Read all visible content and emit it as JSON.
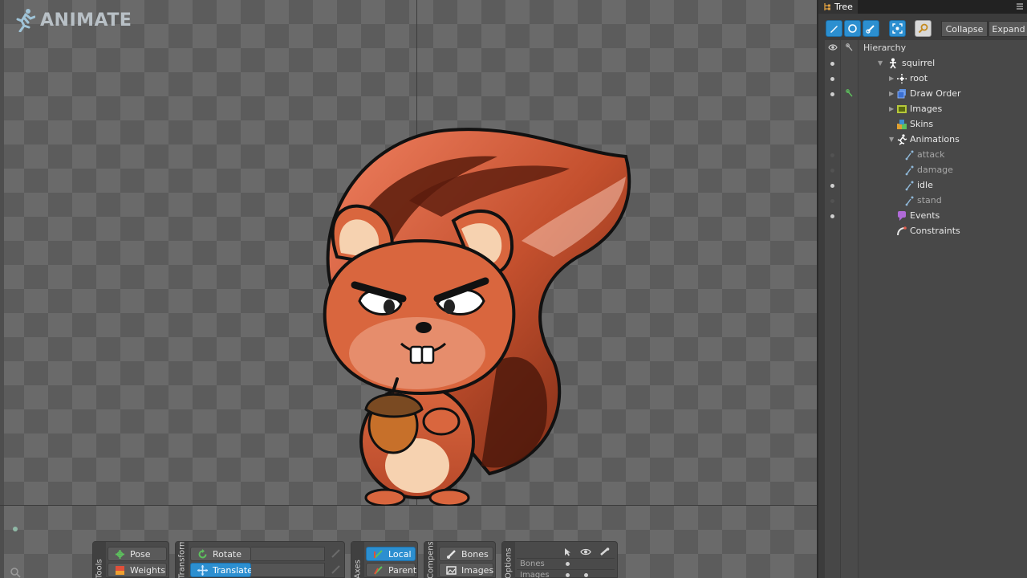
{
  "app": {
    "logo_text": "ANIMATE"
  },
  "panel": {
    "tab_title": "Tree",
    "collapse_label": "Collapse",
    "expand_label": "Expand",
    "hierarchy_label": "Hierarchy"
  },
  "tree": {
    "items": [
      {
        "label": "squirrel",
        "icon": "skeleton-icon"
      },
      {
        "label": "root",
        "icon": "bone-root-icon"
      },
      {
        "label": "Draw Order",
        "icon": "draw-order-icon"
      },
      {
        "label": "Images",
        "icon": "images-folder-icon"
      },
      {
        "label": "Skins",
        "icon": "skins-icon"
      },
      {
        "label": "Animations",
        "icon": "animations-icon"
      },
      {
        "label": "attack",
        "icon": "animation-icon"
      },
      {
        "label": "damage",
        "icon": "animation-icon"
      },
      {
        "label": "idle",
        "icon": "animation-icon"
      },
      {
        "label": "stand",
        "icon": "animation-icon"
      },
      {
        "label": "Events",
        "icon": "events-icon"
      },
      {
        "label": "Constraints",
        "icon": "constraints-icon"
      }
    ]
  },
  "toolbar": {
    "tools_label": "Tools",
    "pose_label": "Pose",
    "weights_label": "Weights",
    "transform_label": "Transform",
    "rotate_label": "Rotate",
    "translate_label": "Translate",
    "axes_label": "Axes",
    "local_label": "Local",
    "parent_label": "Parent",
    "compensate_label": "Compensate",
    "bones_label": "Bones",
    "images_label": "Images",
    "options_label": "Options",
    "options_rows": [
      "Bones",
      "Images"
    ]
  },
  "colors": {
    "accent": "#2c8fd0",
    "panel_bg": "#3c3c3c",
    "viewport_bg": "#5c5c5c"
  }
}
